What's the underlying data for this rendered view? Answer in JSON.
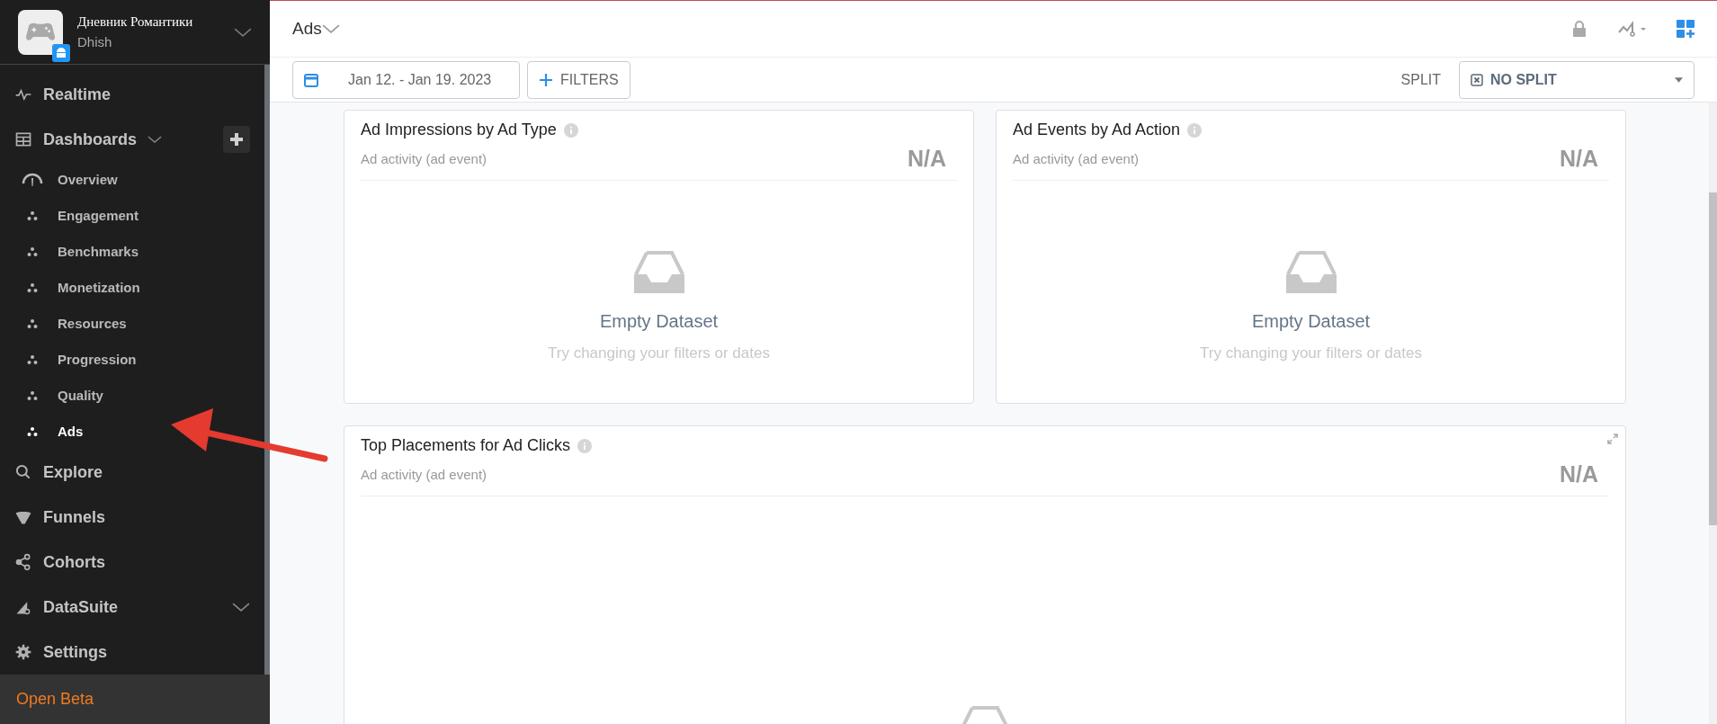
{
  "app": {
    "name": "Дневник Романтики",
    "studio": "Dhish"
  },
  "sidebar": {
    "items": [
      {
        "kind": "top",
        "label": "Realtime",
        "selected": false
      },
      {
        "kind": "group",
        "label": "Dashboards",
        "expanded": true,
        "selected": false
      },
      {
        "kind": "sub",
        "label": "Overview",
        "selected": false
      },
      {
        "kind": "sub",
        "label": "Engagement",
        "selected": false
      },
      {
        "kind": "sub",
        "label": "Benchmarks",
        "selected": false
      },
      {
        "kind": "sub",
        "label": "Monetization",
        "selected": false
      },
      {
        "kind": "sub",
        "label": "Resources",
        "selected": false
      },
      {
        "kind": "sub",
        "label": "Progression",
        "selected": false
      },
      {
        "kind": "sub",
        "label": "Quality",
        "selected": false
      },
      {
        "kind": "sub",
        "label": "Ads",
        "selected": true
      },
      {
        "kind": "top",
        "label": "Explore",
        "selected": false
      },
      {
        "kind": "top",
        "label": "Funnels",
        "selected": false
      },
      {
        "kind": "top",
        "label": "Cohorts",
        "selected": false
      },
      {
        "kind": "group",
        "label": "DataSuite",
        "expanded": false,
        "selected": false
      },
      {
        "kind": "top",
        "label": "Settings",
        "selected": false
      }
    ],
    "footer": "Open Beta"
  },
  "header": {
    "title": "Ads"
  },
  "filters": {
    "date_range": "Jan 12. - Jan 19. 2023",
    "filters_button": "FILTERS",
    "split_label": "SPLIT",
    "split_value": "NO SPLIT"
  },
  "cards": [
    {
      "title": "Ad Impressions by Ad Type",
      "subtitle": "Ad activity (ad event)",
      "value": "N/A",
      "wide": false,
      "empty_title": "Empty Dataset",
      "empty_hint": "Try changing your filters or dates"
    },
    {
      "title": "Ad Events by Ad Action",
      "subtitle": "Ad activity (ad event)",
      "value": "N/A",
      "wide": false,
      "empty_title": "Empty Dataset",
      "empty_hint": "Try changing your filters or dates"
    },
    {
      "title": "Top Placements for Ad Clicks",
      "subtitle": "Ad activity (ad event)",
      "value": "N/A",
      "wide": true
    }
  ]
}
